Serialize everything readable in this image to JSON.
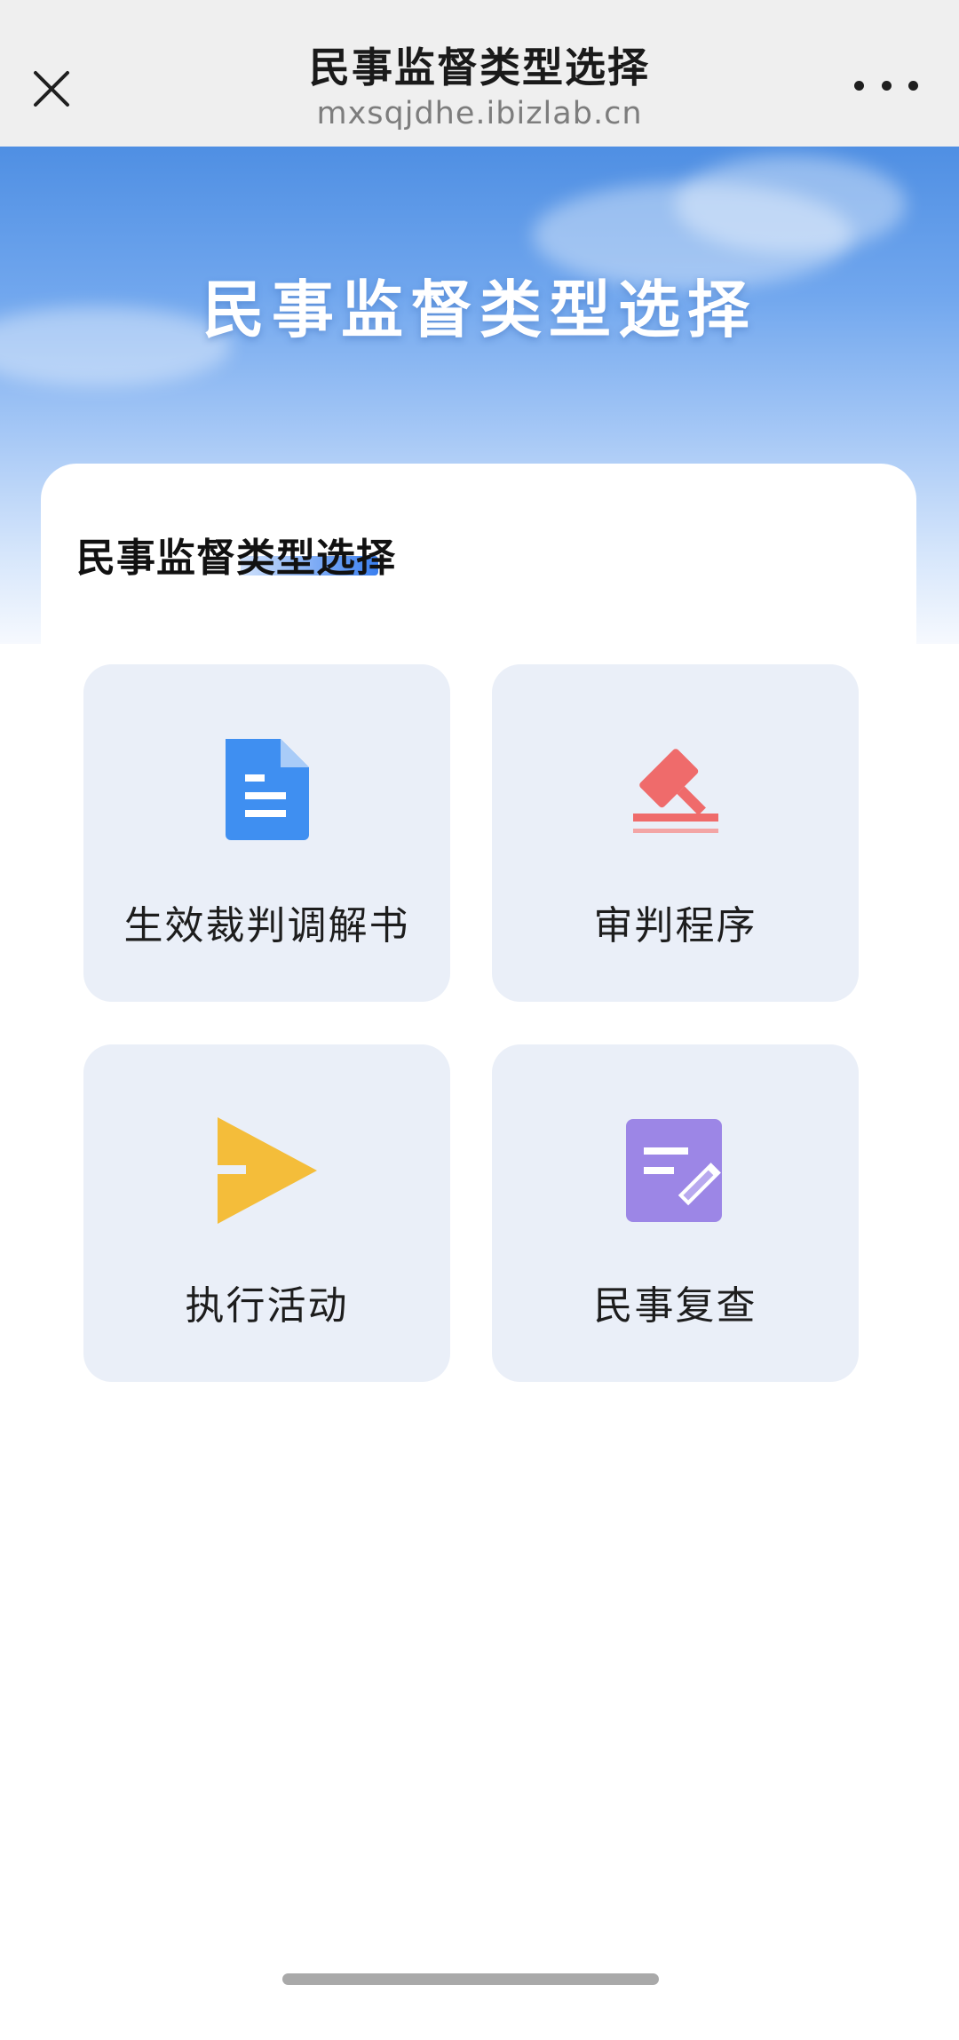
{
  "nav": {
    "title": "民事监督类型选择",
    "url": "mxsqjdhe.ibizlab.cn",
    "close_icon": "close-icon",
    "more_icon": "more-dots-icon"
  },
  "banner": {
    "title": "民事监督类型选择"
  },
  "section": {
    "title": "民事监督类型选择"
  },
  "options": [
    {
      "label": "生效裁判调解书",
      "icon": "document-icon",
      "color": "#3f8ff1"
    },
    {
      "label": "审判程序",
      "icon": "gavel-icon",
      "color": "#ef6b6b"
    },
    {
      "label": "执行活动",
      "icon": "play-arrow-icon",
      "color": "#f4bd3a"
    },
    {
      "label": "民事复查",
      "icon": "edit-icon",
      "color": "#9c86e6"
    }
  ]
}
